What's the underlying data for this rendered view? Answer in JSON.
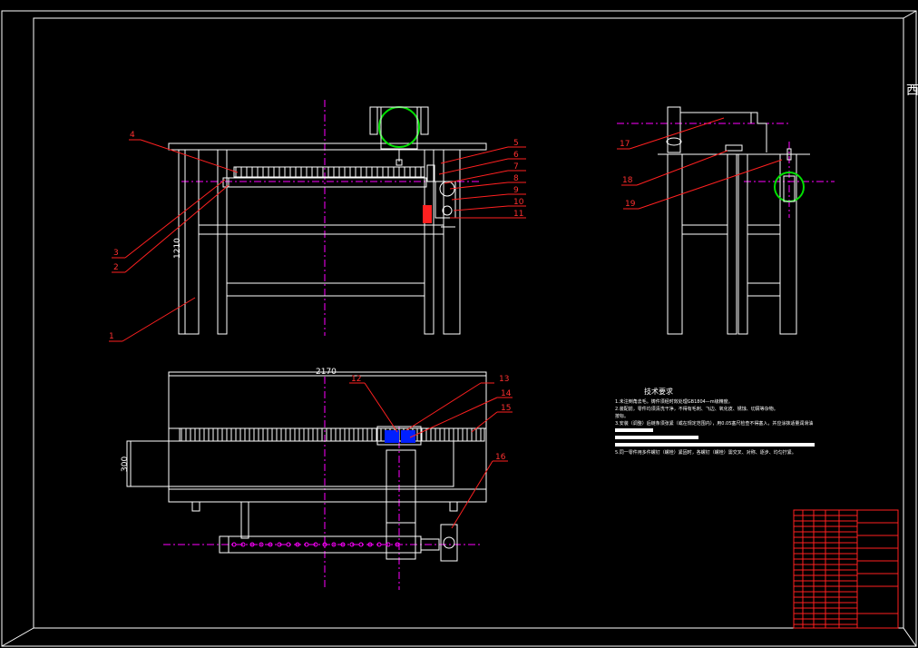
{
  "drawing": {
    "side_tab": "西",
    "callouts_front": [
      "4",
      "3",
      "2",
      "1",
      "5",
      "6",
      "7",
      "8",
      "9",
      "10",
      "11"
    ],
    "callouts_side": [
      "17",
      "18",
      "19"
    ],
    "callouts_top": [
      "12",
      "13",
      "14",
      "15",
      "16"
    ],
    "dim_height": "1210",
    "dim_length": "2170",
    "dim_width": "300"
  },
  "notes": {
    "title": "技术要求",
    "lines": [
      "1.未注倒角去毛。铸件须经时效处理GB1804—m级精度。",
      "2.装配前，零件均须清洗干净，不得有毛刺、飞边、氧化皮、锈蚀、切屑等杂物。",
      "按标。",
      "3.安装（调整）后链条须张紧（或在规定范围内），用0.05塞尺检查不得塞入，并应涂抹适量润滑油",
      "",
      "",
      "5.同一零件用多件螺钉（螺栓）紧固时，各螺钉（螺栓）需交叉、对称、逐步、均匀拧紧。"
    ]
  },
  "colors": {
    "background": "#000000",
    "line": "#ffffff",
    "callout": "#ff2020",
    "centerline": "#ff00ff",
    "motor": "#00e000",
    "highlight": "#0020ff"
  }
}
